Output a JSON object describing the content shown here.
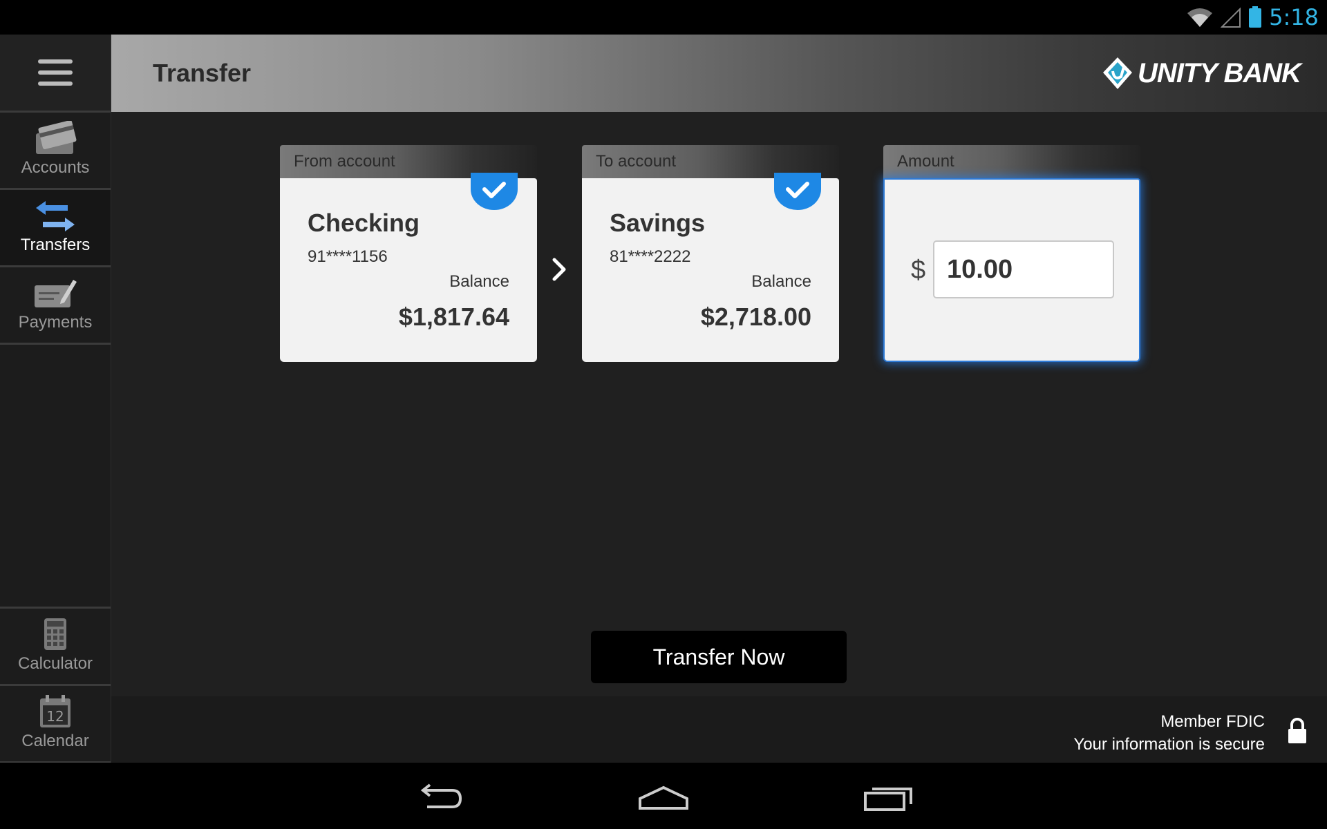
{
  "status": {
    "time": "5:18"
  },
  "sidebar": {
    "menu_icon": "hamburger-menu-icon",
    "items": [
      {
        "label": "Accounts",
        "icon": "credit-card-icon",
        "active": false
      },
      {
        "label": "Transfers",
        "icon": "transfer-arrows-icon",
        "active": true
      },
      {
        "label": "Payments",
        "icon": "check-pen-icon",
        "active": false
      }
    ],
    "bottom_items": [
      {
        "label": "Calculator",
        "icon": "calculator-icon"
      },
      {
        "label": "Calendar",
        "icon": "calendar-icon",
        "icon_text": "12"
      }
    ]
  },
  "header": {
    "title": "Transfer",
    "brand": {
      "main": "UNITY",
      "second": "BANK"
    }
  },
  "from_account": {
    "tab_label": "From account",
    "name": "Checking",
    "number": "91****1156",
    "balance_label": "Balance",
    "balance": "$1,817.64"
  },
  "to_account": {
    "tab_label": "To account",
    "name": "Savings",
    "number": "81****2222",
    "balance_label": "Balance",
    "balance": "$2,718.00"
  },
  "amount": {
    "tab_label": "Amount",
    "currency": "$",
    "value": "10.00"
  },
  "transfer_button": "Transfer Now",
  "footer": {
    "line1": "Member FDIC",
    "line2": "Your information is secure"
  },
  "colors": {
    "accent": "#33b5e5",
    "check_blue": "#1e88e5",
    "focus_blue": "#2f7bd6"
  }
}
